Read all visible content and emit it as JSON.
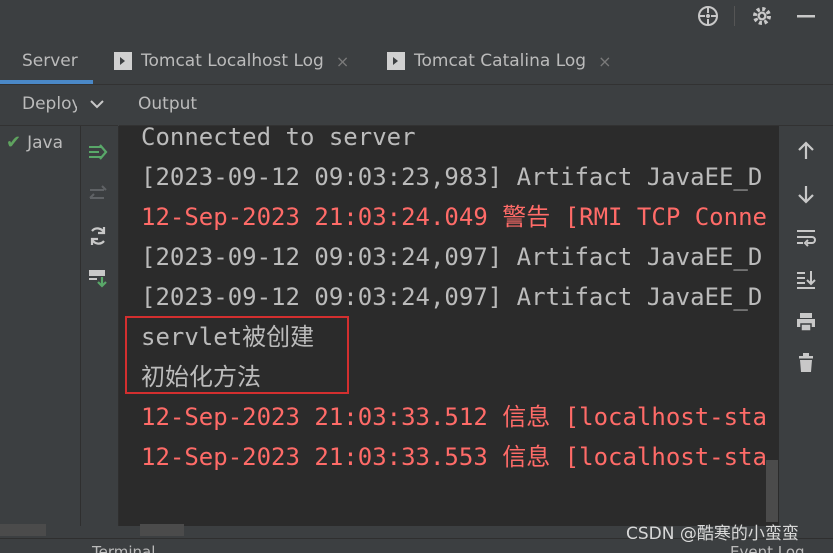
{
  "tabs": [
    {
      "label": "Server",
      "active": true
    },
    {
      "label": "Tomcat Localhost Log",
      "active": false,
      "icon": "terminal-icon"
    },
    {
      "label": "Tomcat Catalina Log",
      "active": false,
      "icon": "terminal-icon"
    }
  ],
  "close_glyph": "×",
  "left_panel": {
    "header": "Deploy",
    "item": "Java"
  },
  "output_header": "Output",
  "console_lines": [
    {
      "text": "Connected to server",
      "color": "gray"
    },
    {
      "text": "[2023-09-12 09:03:23,983] Artifact JavaEE_D",
      "color": "gray"
    },
    {
      "text": "12-Sep-2023 21:03:24.049 警告 [RMI TCP Conne",
      "color": "red"
    },
    {
      "text": "[2023-09-12 09:03:24,097] Artifact JavaEE_D",
      "color": "gray"
    },
    {
      "text": "[2023-09-12 09:03:24,097] Artifact JavaEE_D",
      "color": "gray"
    },
    {
      "text": "servlet被创建",
      "color": "gray"
    },
    {
      "text": "初始化方法",
      "color": "gray"
    },
    {
      "text": "12-Sep-2023 21:03:33.512 信息 [localhost-sta",
      "color": "red"
    },
    {
      "text": "12-Sep-2023 21:03:33.553 信息 [localhost-sta",
      "color": "red"
    }
  ],
  "bottom_items": [
    "Terminal",
    "Event Log"
  ],
  "watermark": "CSDN @酷寒的小蛮蛮",
  "colors": {
    "accent": "#4a88c7",
    "error_text": "#ff6b68",
    "highlight_box": "#d32f2f",
    "ok_check": "#5fa35f"
  }
}
